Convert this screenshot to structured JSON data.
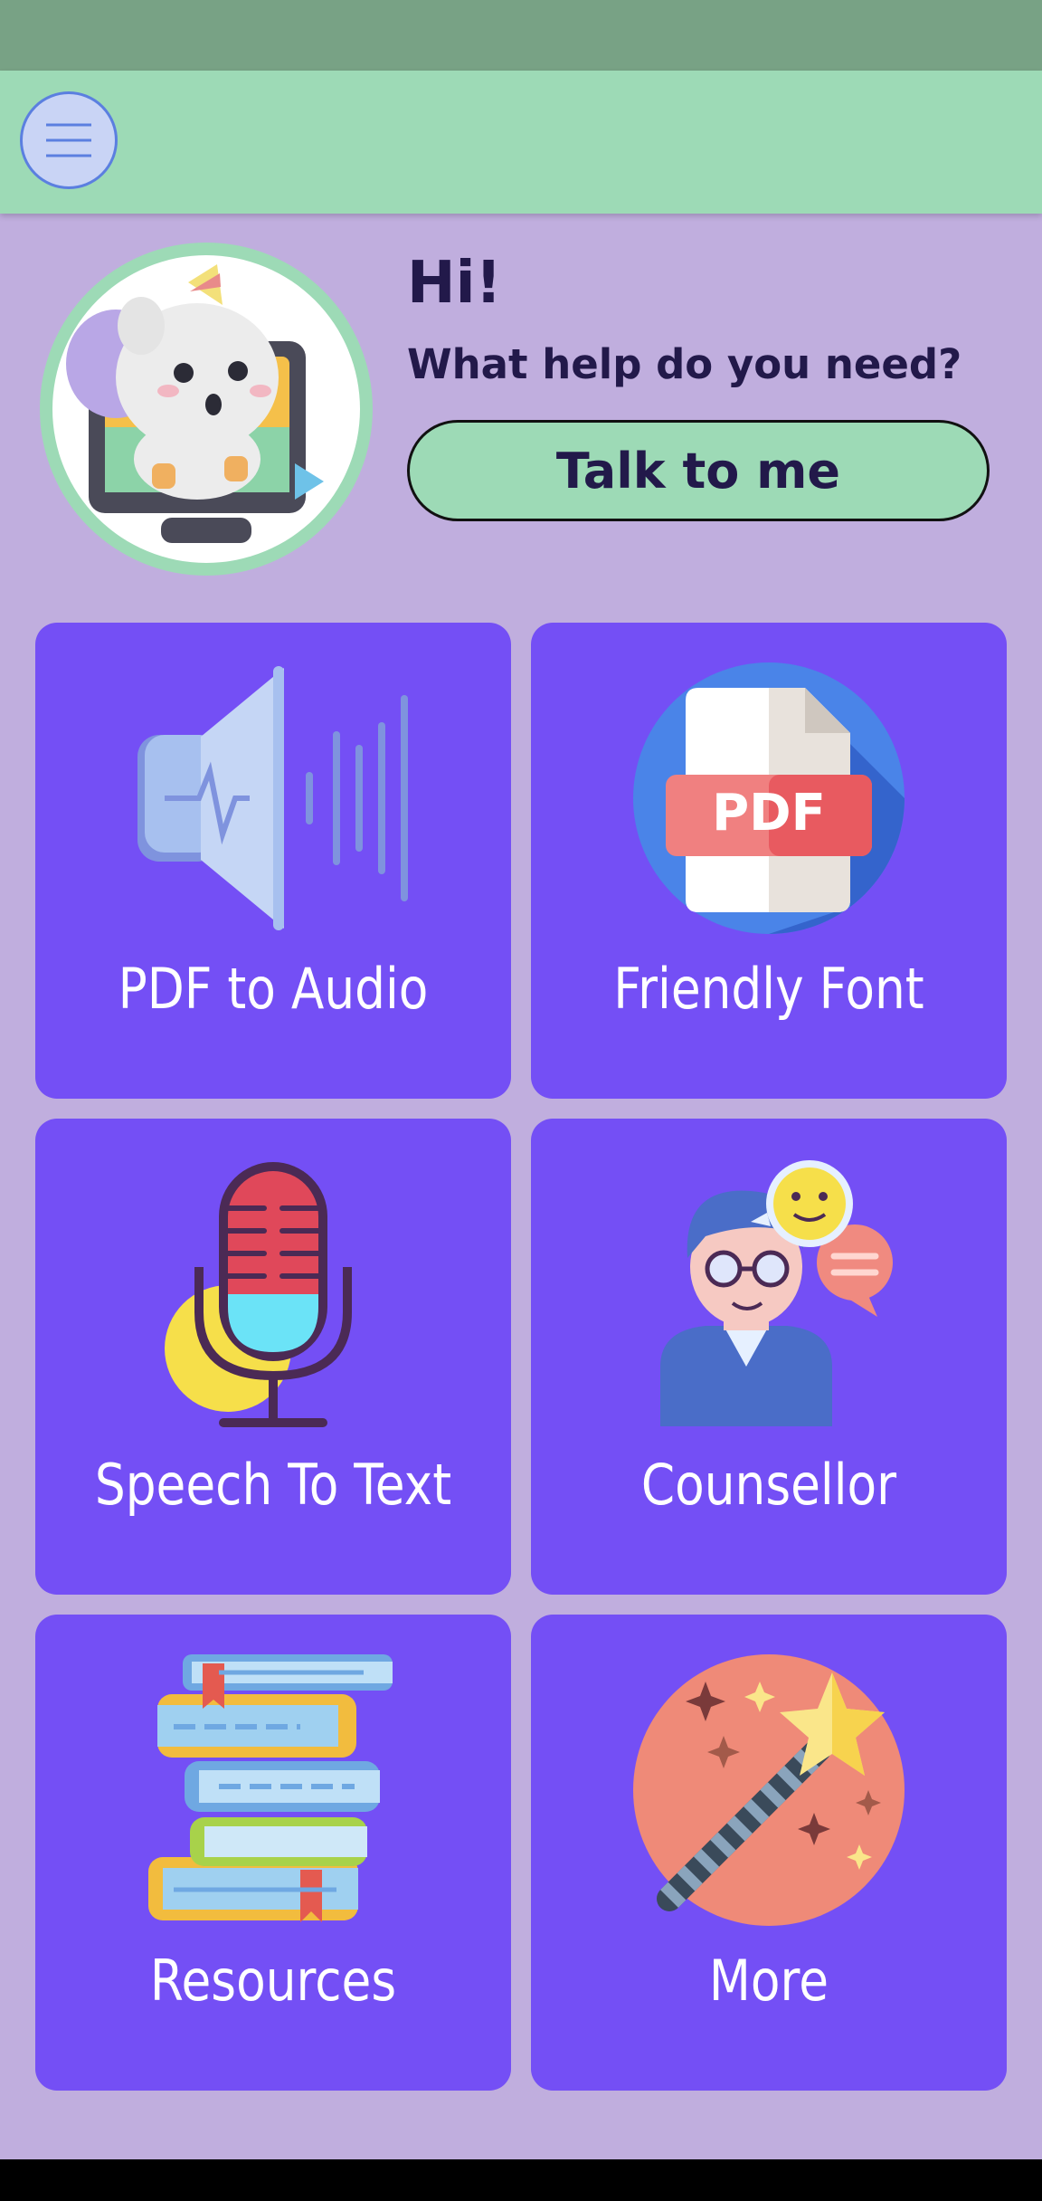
{
  "app_bar": {
    "menu_icon": "hamburger-menu-icon"
  },
  "hero": {
    "avatar_icon": "unicorn-mascot-icon",
    "greeting": "Hi!",
    "question": "What help do you need?",
    "talk_button": "Talk to me"
  },
  "tiles": [
    {
      "label": "PDF to Audio",
      "icon": "speaker-icon"
    },
    {
      "label": "Friendly Font",
      "icon": "pdf-document-icon"
    },
    {
      "label": "Speech To Text",
      "icon": "microphone-icon"
    },
    {
      "label": "Counsellor",
      "icon": "counsellor-person-icon"
    },
    {
      "label": "Resources",
      "icon": "books-stack-icon"
    },
    {
      "label": "More",
      "icon": "magic-wand-icon"
    }
  ],
  "colors": {
    "background": "#c0aede",
    "app_bar": "#9ddab6",
    "status_bar": "#78a285",
    "tile": "#744ff5",
    "text_dark": "#22194a"
  }
}
